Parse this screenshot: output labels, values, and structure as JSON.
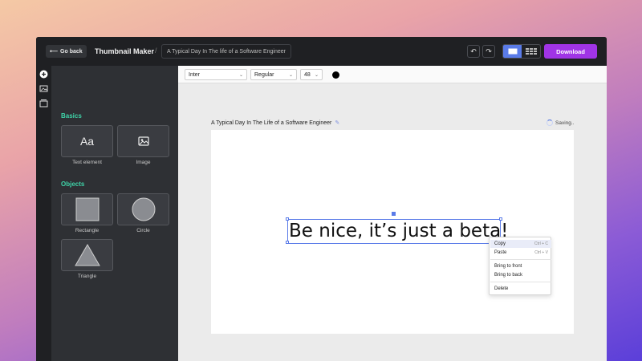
{
  "header": {
    "back_label": "Go back",
    "app_title": "Thumbnail Maker",
    "separator": "/",
    "document_title": "A Typical Day In The life of a Software Engineer",
    "download_label": "Download"
  },
  "toolbar": {
    "font_family": "Inter",
    "font_weight": "Regular",
    "font_size": "48",
    "text_color": "#000000"
  },
  "sidebar": {
    "basics_title": "Basics",
    "objects_title": "Objects",
    "basics": [
      {
        "label": "Text element",
        "glyph": "Aa"
      },
      {
        "label": "Image"
      }
    ],
    "objects": [
      {
        "label": "Rectangle"
      },
      {
        "label": "Circle"
      },
      {
        "label": "Triangle"
      }
    ]
  },
  "canvas": {
    "title": "A Typical Day In The Life of a Software Engineer",
    "status": "Saving..",
    "text_content": "Be nice, it’s just a beta!"
  },
  "context_menu": {
    "items": [
      {
        "label": "Copy",
        "shortcut": "Ctrl + C"
      },
      {
        "label": "Paste",
        "shortcut": "Ctrl + V"
      },
      {
        "label": "Bring to front"
      },
      {
        "label": "Bring to back"
      },
      {
        "label": "Delete"
      }
    ]
  },
  "colors": {
    "accent": "#5a7be8",
    "download": "#a034e6",
    "section_title": "#3fd3a8"
  }
}
